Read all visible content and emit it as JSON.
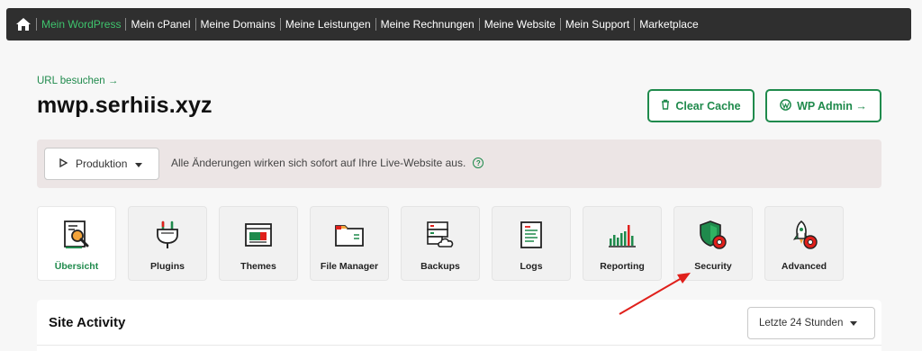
{
  "topnav": {
    "home_icon": "home-icon",
    "items": [
      {
        "label": "Mein WordPress",
        "active": true
      },
      {
        "label": "Mein cPanel",
        "active": false
      },
      {
        "label": "Meine Domains",
        "active": false
      },
      {
        "label": "Meine Leistungen",
        "active": false
      },
      {
        "label": "Meine Rechnungen",
        "active": false
      },
      {
        "label": "Meine Website",
        "active": false
      },
      {
        "label": "Mein Support",
        "active": false
      },
      {
        "label": "Marketplace",
        "active": false
      }
    ]
  },
  "site": {
    "visit_link": "URL besuchen →",
    "domain": "mwp.serhiis.xyz"
  },
  "actions": {
    "clear_cache": "Clear Cache",
    "wp_admin": "WP Admin →"
  },
  "environment": {
    "selected": "Produktion",
    "note": "Alle Änderungen wirken sich sofort auf Ihre Live-Website aus."
  },
  "tabs": [
    {
      "label": "Übersicht",
      "icon": "overview-icon",
      "active": true
    },
    {
      "label": "Plugins",
      "icon": "plug-icon",
      "active": false
    },
    {
      "label": "Themes",
      "icon": "theme-icon",
      "active": false
    },
    {
      "label": "File Manager",
      "icon": "folder-icon",
      "active": false
    },
    {
      "label": "Backups",
      "icon": "server-cloud-icon",
      "active": false
    },
    {
      "label": "Logs",
      "icon": "logs-icon",
      "active": false
    },
    {
      "label": "Reporting",
      "icon": "bar-chart-icon",
      "active": false
    },
    {
      "label": "Security",
      "icon": "shield-gear-icon",
      "active": false
    },
    {
      "label": "Advanced",
      "icon": "rocket-gear-icon",
      "active": false
    }
  ],
  "activity": {
    "title": "Site Activity",
    "range": "Letzte 24 Stunden"
  },
  "colors": {
    "accent": "#1f8a4c",
    "accent_light": "#3ec46d",
    "topbar": "#2f2f2f",
    "alert_bg": "#ece5e5",
    "annotation_arrow": "#e0201b"
  }
}
